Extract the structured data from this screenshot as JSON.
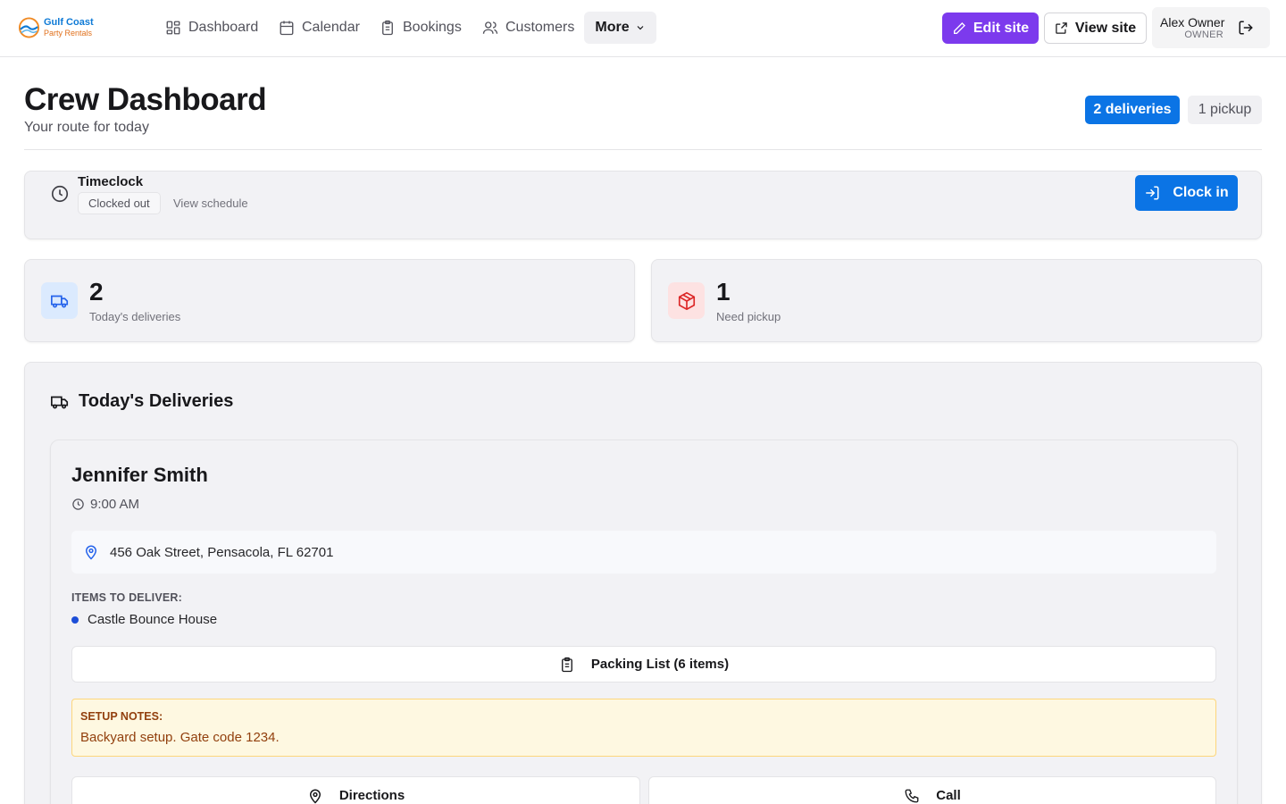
{
  "brand": {
    "name": "Gulf Coast",
    "tagline": "Party Rentals"
  },
  "nav": {
    "items": [
      {
        "label": "Dashboard",
        "icon": "dashboard-grid-icon"
      },
      {
        "label": "Calendar",
        "icon": "calendar-icon"
      },
      {
        "label": "Bookings",
        "icon": "clipboard-icon"
      },
      {
        "label": "Customers",
        "icon": "users-icon"
      }
    ],
    "more_label": "More"
  },
  "toolbar": {
    "edit_label": "Edit site",
    "view_label": "View site"
  },
  "user": {
    "name": "Alex Owner",
    "role": "OWNER"
  },
  "header": {
    "title": "Crew Dashboard",
    "subtitle": "Your route for today",
    "deliveries_pill": "2 deliveries",
    "pickup_pill": "1 pickup"
  },
  "timeclock": {
    "title": "Timeclock",
    "status": "Clocked out",
    "schedule_link": "View schedule",
    "clock_in_label": "Clock in"
  },
  "stats": [
    {
      "value": "2",
      "label": "Today's deliveries",
      "icon": "truck-icon",
      "color": "#2563eb"
    },
    {
      "value": "1",
      "label": "Need pickup",
      "icon": "package-icon",
      "color": "#dc2626"
    }
  ],
  "deliveries": {
    "section_title": "Today's Deliveries",
    "items": [
      {
        "customer": "Jennifer Smith",
        "time": "9:00 AM",
        "address": "456 Oak Street, Pensacola, FL 62701",
        "items_label": "ITEMS TO DELIVER:",
        "items": [
          "Castle Bounce House"
        ],
        "packing_label": "Packing List (6 items)",
        "notes_label": "SETUP NOTES:",
        "notes": "Backyard setup. Gate code 1234.",
        "directions_label": "Directions",
        "call_label": "Call"
      }
    ]
  },
  "colors": {
    "accent_blue": "#0b74e5",
    "edit_purple": "#7c3aed",
    "notes_bg": "#fef8e1",
    "notes_text": "#92400e"
  }
}
